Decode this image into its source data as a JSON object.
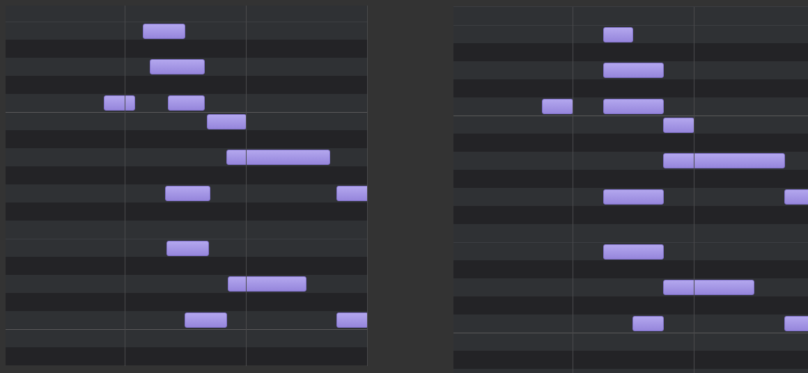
{
  "panels": [
    {
      "rows": [
        {
          "kind": "white",
          "octave_line": false
        },
        {
          "kind": "white",
          "octave_line": false
        },
        {
          "kind": "black",
          "octave_line": false
        },
        {
          "kind": "white",
          "octave_line": false
        },
        {
          "kind": "black",
          "octave_line": false
        },
        {
          "kind": "white",
          "octave_line": false
        },
        {
          "kind": "white",
          "octave_line": true
        },
        {
          "kind": "black",
          "octave_line": false
        },
        {
          "kind": "white",
          "octave_line": false
        },
        {
          "kind": "black",
          "octave_line": false
        },
        {
          "kind": "white",
          "octave_line": false
        },
        {
          "kind": "black",
          "octave_line": false
        },
        {
          "kind": "white",
          "octave_line": false
        },
        {
          "kind": "white",
          "octave_line": false
        },
        {
          "kind": "black",
          "octave_line": false
        },
        {
          "kind": "white",
          "octave_line": false
        },
        {
          "kind": "black",
          "octave_line": false
        },
        {
          "kind": "white",
          "octave_line": false
        },
        {
          "kind": "white",
          "octave_line": true
        },
        {
          "kind": "black",
          "octave_line": false
        }
      ]
    },
    {
      "rows": [
        {
          "kind": "white",
          "octave_line": false
        },
        {
          "kind": "white",
          "octave_line": false
        },
        {
          "kind": "black",
          "octave_line": false
        },
        {
          "kind": "white",
          "octave_line": false
        },
        {
          "kind": "black",
          "octave_line": false
        },
        {
          "kind": "white",
          "octave_line": false
        },
        {
          "kind": "white",
          "octave_line": true
        },
        {
          "kind": "black",
          "octave_line": false
        },
        {
          "kind": "white",
          "octave_line": false
        },
        {
          "kind": "black",
          "octave_line": false
        },
        {
          "kind": "white",
          "octave_line": false
        },
        {
          "kind": "black",
          "octave_line": false
        },
        {
          "kind": "white",
          "octave_line": false
        },
        {
          "kind": "white",
          "octave_line": false
        },
        {
          "kind": "black",
          "octave_line": false
        },
        {
          "kind": "white",
          "octave_line": false
        },
        {
          "kind": "black",
          "octave_line": false
        },
        {
          "kind": "white",
          "octave_line": false
        },
        {
          "kind": "white",
          "octave_line": true
        },
        {
          "kind": "black",
          "octave_line": false
        },
        {
          "kind": "white",
          "octave_line": false
        }
      ]
    }
  ]
}
